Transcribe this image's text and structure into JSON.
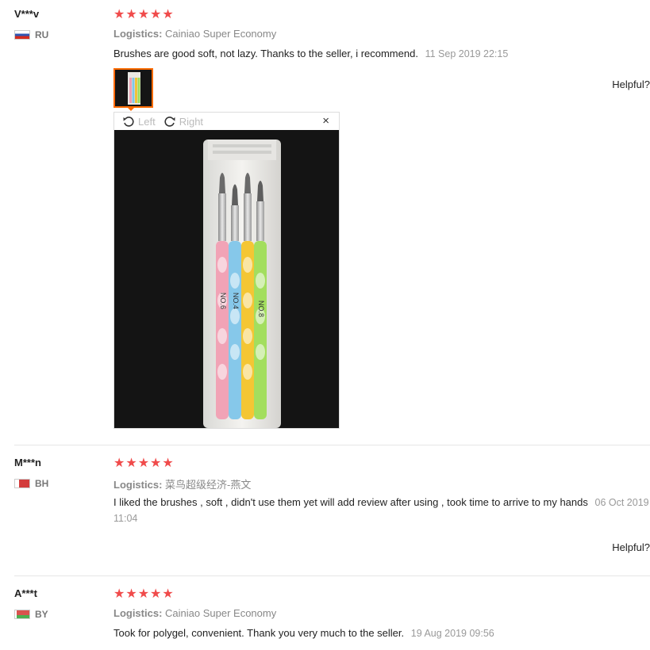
{
  "reviews": [
    {
      "user": "V***v",
      "country": "RU",
      "stars": "★★★★★",
      "logistics_label": "Logistics:",
      "logistics_value": "Cainiao Super Economy",
      "text": "Brushes are good soft, not lazy. Thanks to the seller, i recommend.",
      "date": "11 Sep 2019 22:15",
      "helpful": "Helpful?"
    },
    {
      "user": "M***n",
      "country": "BH",
      "stars": "★★★★★",
      "logistics_label": "Logistics:",
      "logistics_value": "菜鸟超级经济-燕文",
      "text": "I liked the brushes , soft , didn't use them yet will add review after using , took time to arrive to my hands",
      "date": "06 Oct 2019 11:04",
      "helpful": "Helpful?"
    },
    {
      "user": "A***t",
      "country": "BY",
      "stars": "★★★★★",
      "logistics_label": "Logistics:",
      "logistics_value": "Cainiao Super Economy",
      "text": "Took for polygel, convenient. Thank you very much to the seller.",
      "date": "19 Aug 2019 09:56"
    }
  ],
  "viewer": {
    "rotate_left": "Left",
    "rotate_right": "Right",
    "close": "×",
    "product_labels": [
      "NO.4",
      "NO.6",
      "NO.8"
    ]
  },
  "colors": {
    "stars": "#f04b4b",
    "thumb_border": "#ff6a00"
  }
}
